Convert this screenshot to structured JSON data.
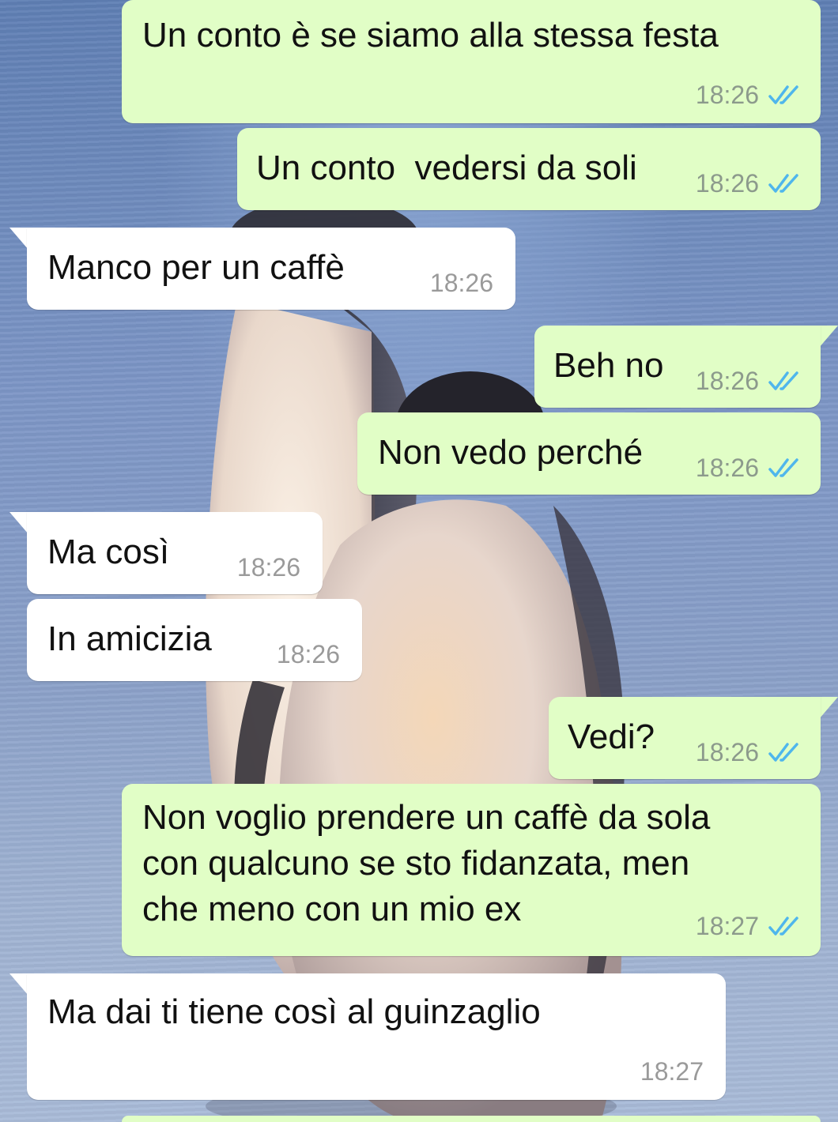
{
  "chat": {
    "messages": [
      {
        "direction": "out",
        "text": "Un conto è se siamo alla stessa festa",
        "time": "18:26",
        "status": "read"
      },
      {
        "direction": "out",
        "text": "Un conto  vedersi da soli",
        "time": "18:26",
        "status": "read"
      },
      {
        "direction": "in",
        "text": "Manco per un caffè",
        "time": "18:26"
      },
      {
        "direction": "out",
        "text": "Beh no",
        "time": "18:26",
        "status": "read"
      },
      {
        "direction": "out",
        "text": "Non vedo perché",
        "time": "18:26",
        "status": "read"
      },
      {
        "direction": "in",
        "text": "Ma così",
        "time": "18:26"
      },
      {
        "direction": "in",
        "text": "In amicizia",
        "time": "18:26"
      },
      {
        "direction": "out",
        "text": "Vedi?",
        "time": "18:26",
        "status": "read"
      },
      {
        "direction": "out",
        "lines": [
          "Non voglio prendere un caffè da sola",
          "con qualcuno se sto fidanzata, men",
          "che meno con un mio ex"
        ],
        "time": "18:27",
        "status": "read"
      },
      {
        "direction": "in",
        "text": "Ma dai ti tiene così al guinzaglio",
        "time": "18:27"
      }
    ]
  },
  "colors": {
    "outgoing_bubble": "#e1fec6",
    "incoming_bubble": "#ffffff",
    "read_tick": "#4fb6ec",
    "timestamp": "#8c9a8c"
  },
  "icons": {
    "read_status": "double-check-icon",
    "wallpaper": "penguins-wallpaper"
  }
}
